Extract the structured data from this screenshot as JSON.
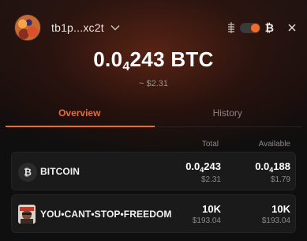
{
  "header": {
    "address": "tb1p...xc2t",
    "currency_toggle_label": "₿"
  },
  "balance": {
    "main_prefix": "0.0",
    "main_sub": "4",
    "main_suffix": "243 BTC",
    "usd": "~ $2.31"
  },
  "tabs": [
    {
      "label": "Overview",
      "active": true
    },
    {
      "label": "History",
      "active": false
    }
  ],
  "table": {
    "columns": [
      "Total",
      "Available"
    ],
    "rows": [
      {
        "icon": "₿",
        "name": "BITCOIN",
        "total_prefix": "0.0",
        "total_sub": "4",
        "total_suffix": "243",
        "total_usd": "$2.31",
        "avail_prefix": "0.0",
        "avail_sub": "4",
        "avail_suffix": "188",
        "avail_usd": "$1.79"
      },
      {
        "icon": "freedom-token-image",
        "name": "YOU•CANT•STOP•FREEDOM",
        "total_prefix": "10K",
        "total_sub": "",
        "total_suffix": "",
        "total_usd": "$193.04",
        "avail_prefix": "10K",
        "avail_sub": "",
        "avail_suffix": "",
        "avail_usd": "$193.04"
      }
    ]
  },
  "colors": {
    "accent": "#f06a30",
    "background": "#0f0f0f",
    "row_background": "#1a1a1a",
    "muted_text": "#8e8886"
  }
}
